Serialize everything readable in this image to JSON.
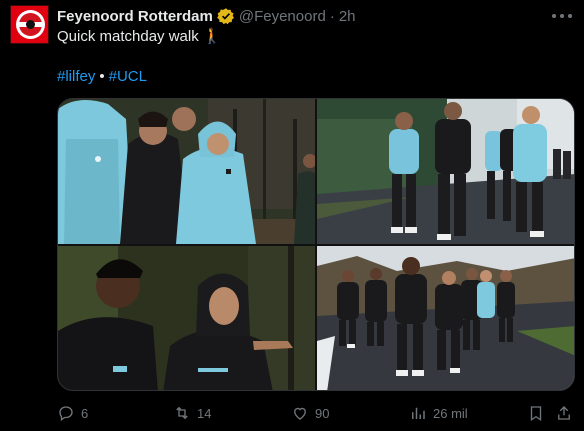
{
  "post": {
    "display_name": "Feyenoord Rotterdam",
    "handle": "@Feyenoord",
    "separator": "·",
    "time": "2h",
    "text": "Quick matchday walk",
    "emoji": "🚶",
    "hashtags": [
      "#lilfey",
      "#UCL"
    ],
    "hashtag_separator": "•"
  },
  "icons": {
    "avatar": "feyenoord-logo",
    "verified": "verified-badge-icon",
    "more": "more-icon",
    "reply": "reply-icon",
    "repost": "repost-icon",
    "like": "like-icon",
    "views": "views-icon",
    "bookmark": "bookmark-icon",
    "share": "share-icon"
  },
  "actions": {
    "reply_count": "6",
    "repost_count": "14",
    "like_count": "90",
    "views_count": "26 mil"
  },
  "colors": {
    "background": "#000000",
    "text": "#e7e9ea",
    "muted": "#71767b",
    "link": "#1d9bf0",
    "verified": "#e2b719",
    "brand_red": "#e1000f"
  }
}
